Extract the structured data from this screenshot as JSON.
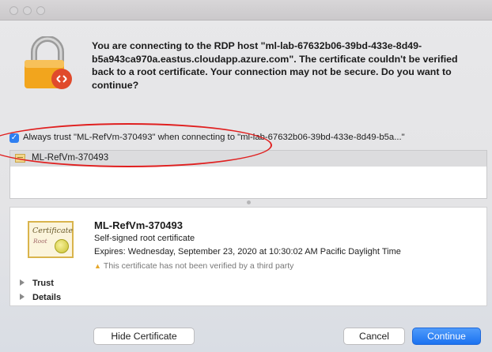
{
  "dialog": {
    "message": "You are connecting to the RDP host \"ml-lab-67632b06-39bd-433e-8d49-b5a943ca970a.eastus.cloudapp.azure.com\". The certificate couldn't be verified back to a root certificate. Your connection may not be secure. Do you want to continue?",
    "always_trust_label": "Always trust \"ML-RefVm-370493\" when connecting to \"ml-lab-67632b06-39bd-433e-8d49-b5a...\"",
    "always_trust_checked": true
  },
  "cert_list": {
    "items": [
      {
        "label": "ML-RefVm-370493"
      }
    ]
  },
  "certificate": {
    "image_text_1": "Certificate",
    "image_text_2": "Root",
    "name": "ML-RefVm-370493",
    "type": "Self-signed root certificate",
    "expires": "Expires: Wednesday, September 23, 2020 at 10:30:02 AM Pacific Daylight Time",
    "warning": "This certificate has not been verified by a third party",
    "sections": [
      "Trust",
      "Details"
    ]
  },
  "buttons": {
    "hide_certificate": "Hide Certificate",
    "cancel": "Cancel",
    "continue": "Continue"
  },
  "colors": {
    "accent": "#1b72f0",
    "annotation": "#e02020",
    "warning": "#e6a72a"
  }
}
